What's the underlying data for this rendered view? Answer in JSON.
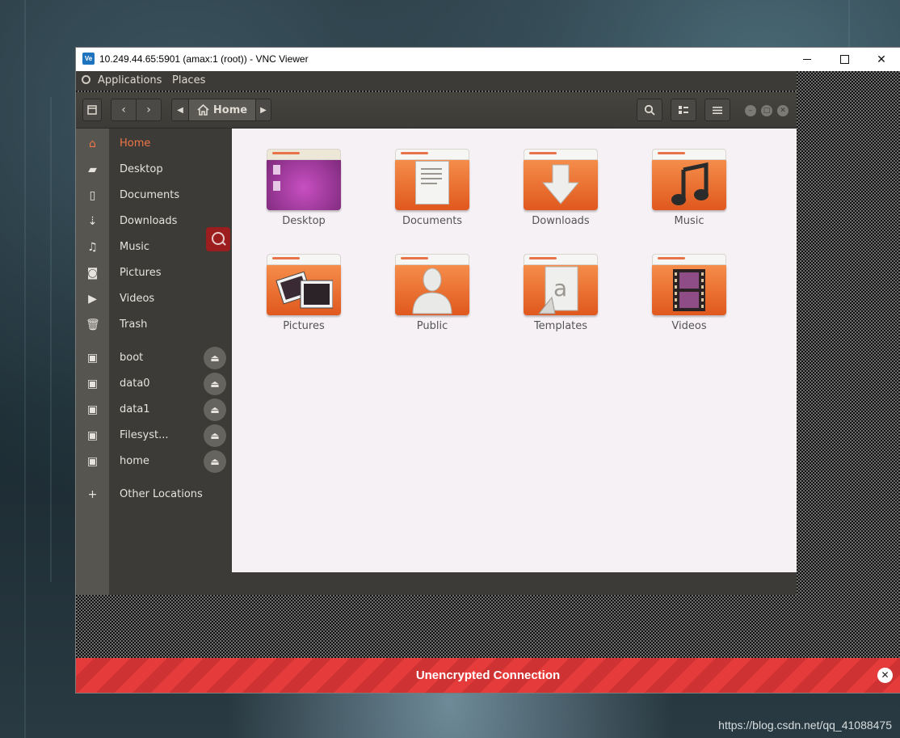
{
  "vnc": {
    "app_icon_text": "Ve",
    "title": "10.249.44.65:5901 (amax:1 (root)) - VNC Viewer",
    "banner_text": "Unencrypted Connection"
  },
  "top_panel": {
    "applications": "Applications",
    "places": "Places"
  },
  "headerbar": {
    "location": "Home"
  },
  "sidebar": {
    "items": [
      {
        "label": "Home",
        "icon": "home-icon",
        "active": true
      },
      {
        "label": "Desktop",
        "icon": "desktop-icon"
      },
      {
        "label": "Documents",
        "icon": "document-icon"
      },
      {
        "label": "Downloads",
        "icon": "download-icon"
      },
      {
        "label": "Music",
        "icon": "music-icon"
      },
      {
        "label": "Pictures",
        "icon": "camera-icon"
      },
      {
        "label": "Videos",
        "icon": "video-icon"
      },
      {
        "label": "Trash",
        "icon": "trash-icon"
      }
    ],
    "drives": [
      {
        "label": "boot"
      },
      {
        "label": "data0"
      },
      {
        "label": "data1"
      },
      {
        "label": "Filesyst..."
      },
      {
        "label": "home"
      }
    ],
    "other_locations": "Other Locations"
  },
  "files": [
    {
      "name": "Desktop"
    },
    {
      "name": "Documents"
    },
    {
      "name": "Downloads"
    },
    {
      "name": "Music"
    },
    {
      "name": "Pictures"
    },
    {
      "name": "Public"
    },
    {
      "name": "Templates"
    },
    {
      "name": "Videos"
    }
  ],
  "watermark": "https://blog.csdn.net/qq_41088475",
  "colors": {
    "accent": "#f07746",
    "banner": "#e53b3b",
    "panel": "#3c3b37"
  }
}
